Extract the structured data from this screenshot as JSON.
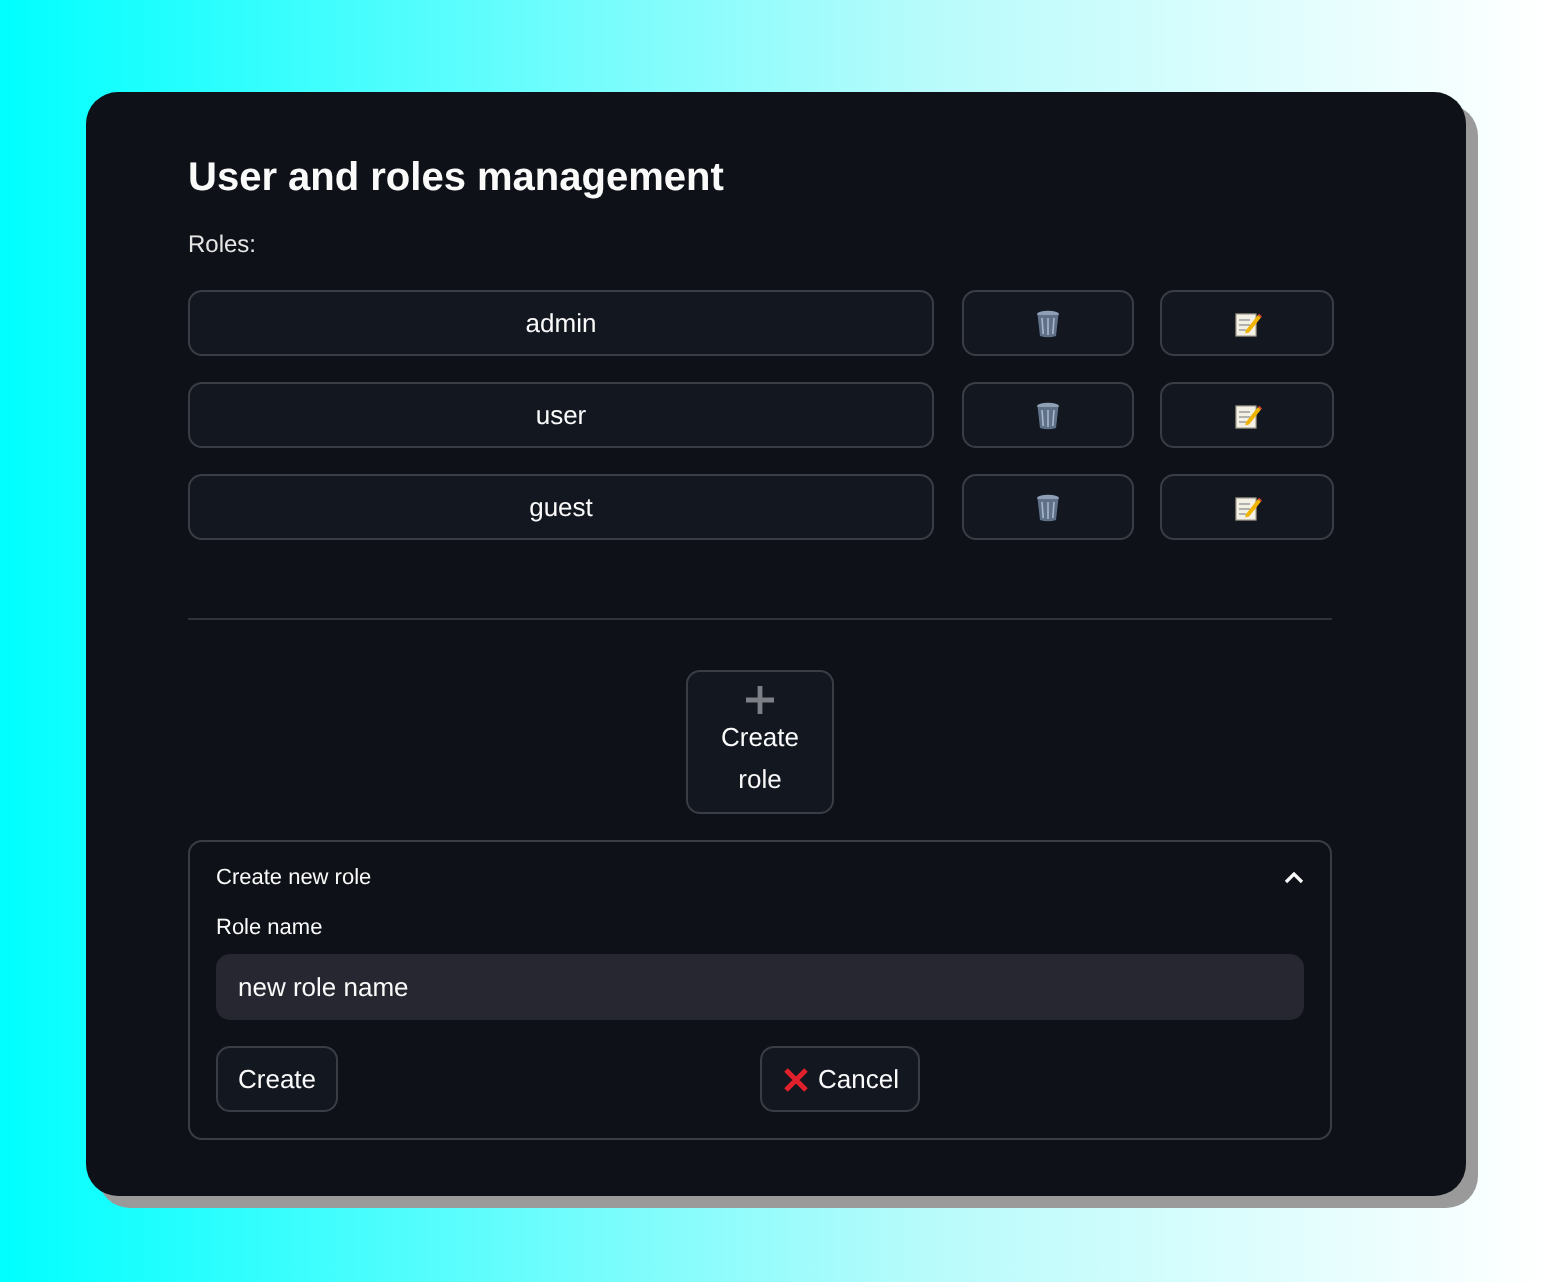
{
  "title": "User and roles management",
  "roles_label": "Roles:",
  "roles": [
    {
      "name": "admin"
    },
    {
      "name": "user"
    },
    {
      "name": "guest"
    }
  ],
  "create_role_button": {
    "label": "Create role"
  },
  "create_panel": {
    "title": "Create new role",
    "expanded": true,
    "field_label": "Role name",
    "value": "new role name",
    "create_label": "Create",
    "cancel_label": "Cancel"
  }
}
